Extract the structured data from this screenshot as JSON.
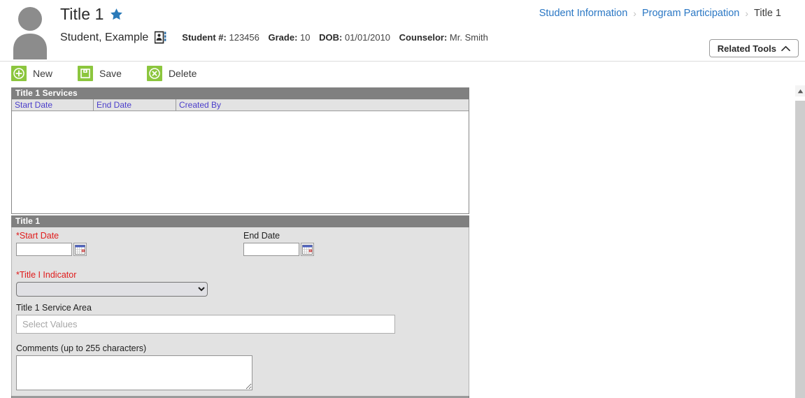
{
  "header": {
    "page_title": "Title 1",
    "favorite_icon": "star-icon",
    "avatar_icon": "person-placeholder-icon",
    "student_name": "Student, Example",
    "contact_card_icon": "contact-card-icon",
    "meta": {
      "student_number_label": "Student #:",
      "student_number_value": "123456",
      "grade_label": "Grade:",
      "grade_value": "10",
      "dob_label": "DOB:",
      "dob_value": "01/01/2010",
      "counselor_label": "Counselor:",
      "counselor_value": "Mr. Smith"
    },
    "breadcrumb": [
      {
        "label": "Student Information",
        "current": false
      },
      {
        "label": "Program Participation",
        "current": false
      },
      {
        "label": "Title 1",
        "current": true
      }
    ],
    "breadcrumb_separator": "›",
    "related_tools": {
      "label": "Related Tools",
      "chevron_icon": "chevron-up-icon"
    }
  },
  "toolbar": {
    "actions": [
      {
        "label": "New",
        "icon": "plus-circle-icon"
      },
      {
        "label": "Save",
        "icon": "floppy-disk-icon"
      },
      {
        "label": "Delete",
        "icon": "x-circle-icon"
      }
    ]
  },
  "services_grid": {
    "title": "Title 1 Services",
    "columns": [
      "Start Date",
      "End Date",
      "Created By"
    ],
    "rows": []
  },
  "detail": {
    "title": "Title 1",
    "start_date": {
      "label": "*Start Date",
      "required": true,
      "value": "",
      "calendar_icon": "calendar-icon"
    },
    "end_date": {
      "label": "End Date",
      "required": false,
      "value": "",
      "calendar_icon": "calendar-icon"
    },
    "title_i_indicator": {
      "label": "*Title I Indicator",
      "required": true,
      "value": "",
      "options": [
        ""
      ]
    },
    "service_area": {
      "label": "Title 1 Service Area",
      "placeholder": "Select Values",
      "value": ""
    },
    "comments": {
      "label": "Comments (up to 255 characters)",
      "value": "",
      "placeholder": ""
    }
  },
  "scrollbar": {
    "up_arrow_icon": "caret-up-icon"
  },
  "colors": {
    "accent_green": "#8cc63e",
    "link_blue": "#2a77c4",
    "required_red": "#e01b1b",
    "panel_header_gray": "#808080",
    "grid_header_text": "#4b3ecb",
    "star_blue": "#2a7ab9"
  }
}
